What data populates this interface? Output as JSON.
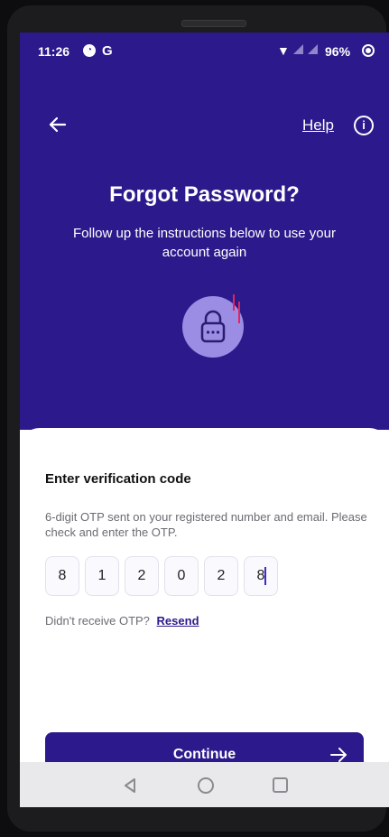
{
  "status_bar": {
    "time": "11:26",
    "battery": "96%"
  },
  "header": {
    "help_label": "Help",
    "title": "Forgot Password?",
    "subtitle": "Follow up the instructions below to use your account again"
  },
  "otp_section": {
    "title": "Enter verification code",
    "description": "6-digit OTP sent on your registered number and email. Please check and enter the OTP.",
    "digits": [
      "8",
      "1",
      "2",
      "0",
      "2",
      "8"
    ],
    "resend_prompt": "Didn't receive OTP?",
    "resend_label": "Resend"
  },
  "actions": {
    "continue_label": "Continue"
  },
  "colors": {
    "brand": "#2c1a8c",
    "lock_circle": "#9b8de3",
    "accent_mark": "#e0245e"
  },
  "icons": {
    "back": "arrow-left-icon",
    "help": "info-circle-icon",
    "lock": "lock-icon",
    "continue": "arrow-right-icon"
  }
}
